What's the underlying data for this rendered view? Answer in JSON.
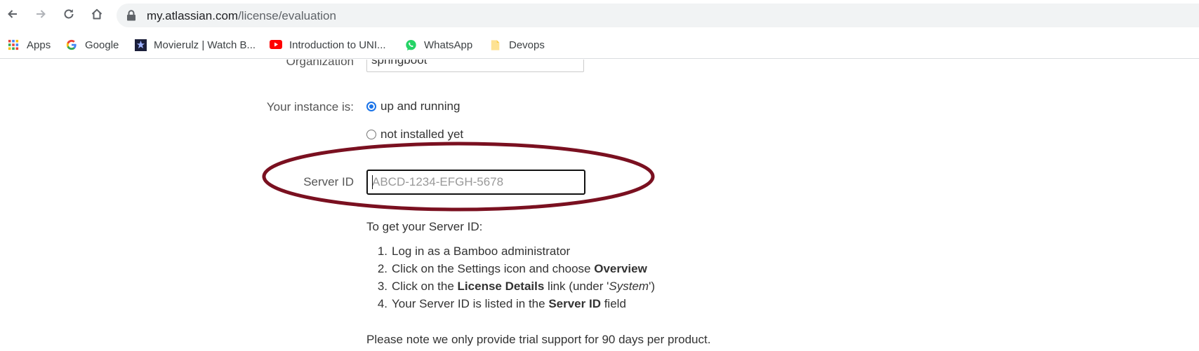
{
  "browser": {
    "url_host": "my.atlassian.com",
    "url_path": "/license/evaluation",
    "bookmarks": [
      {
        "label": "Apps",
        "icon": "apps-grid-icon"
      },
      {
        "label": "Google",
        "icon": "google-icon"
      },
      {
        "label": "Movierulz | Watch B...",
        "icon": "movierulz-icon"
      },
      {
        "label": "Introduction to UNI...",
        "icon": "youtube-icon"
      },
      {
        "label": "WhatsApp",
        "icon": "whatsapp-icon"
      },
      {
        "label": "Devops",
        "icon": "folder-icon"
      }
    ]
  },
  "form": {
    "organization_label": "Organization",
    "organization_value": "springboot",
    "instance_label": "Your instance is:",
    "instance_options": [
      "up and running",
      "not installed yet"
    ],
    "instance_selected": "up and running",
    "server_id_label": "Server ID",
    "server_id_placeholder": "ABCD-1234-EFGH-5678",
    "server_id_value": ""
  },
  "help": {
    "title": "To get your Server ID:",
    "steps": [
      {
        "num": "1.",
        "parts": [
          "Log in as a Bamboo administrator"
        ]
      },
      {
        "num": "2.",
        "parts": [
          "Click on the Settings icon and choose ",
          "Overview"
        ]
      },
      {
        "num": "3.",
        "parts": [
          "Click on the ",
          "License Details",
          " link (under '",
          "System",
          "')"
        ]
      },
      {
        "num": "4.",
        "parts": [
          "Your Server ID is listed in the ",
          "Server ID",
          " field"
        ]
      }
    ],
    "note": "Please note we only provide trial support for 90 days per product."
  },
  "colors": {
    "annotation_ellipse": "#7a1020",
    "radio_accent": "#1a73e8"
  }
}
